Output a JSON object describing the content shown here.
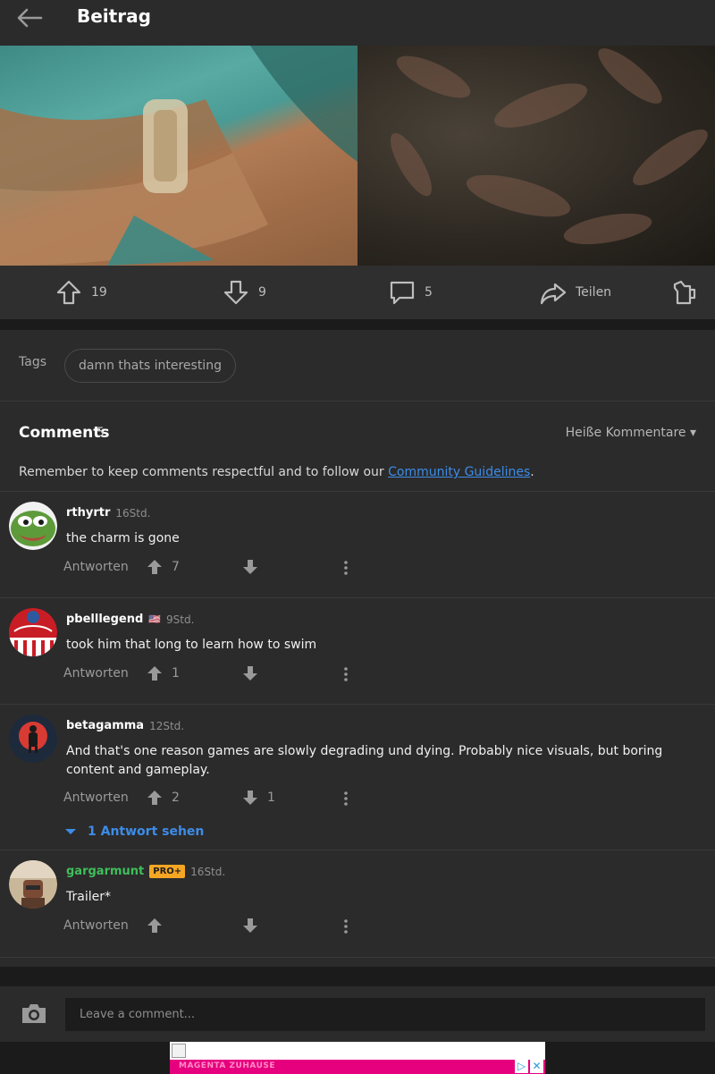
{
  "header": {
    "title": "Beitrag",
    "back_icon": "arrow-left-icon"
  },
  "post_actions": {
    "upvotes": "19",
    "downvotes": "9",
    "comments": "5",
    "share_label": "Teilen"
  },
  "tags": {
    "label": "Tags",
    "items": [
      "damn thats interesting"
    ]
  },
  "comments_section": {
    "title": "Comments",
    "count": "5",
    "sort_label": "Heiße Kommentare ▾",
    "guidelines_prefix": "Remember to keep comments respectful and to follow our ",
    "guidelines_link": "Community Guidelines",
    "guidelines_suffix": "."
  },
  "comments": [
    {
      "author": "rthyrtr",
      "time": "16Std.",
      "text": "the charm is gone",
      "reply_label": "Antworten",
      "up": "7",
      "down": ""
    },
    {
      "author": "pbelllegend",
      "flag": "🇺🇸",
      "time": "9Std.",
      "text": "took him that long to learn how to swim",
      "reply_label": "Antworten",
      "up": "1",
      "down": ""
    },
    {
      "author": "betagamma",
      "time": "12Std.",
      "text": "And that's one reason games are slowly degrading und dying. Probably nice visuals, but boring content and gameplay.",
      "reply_label": "Antworten",
      "up": "2",
      "down": "1",
      "see_replies": "1 Antwort sehen"
    },
    {
      "author": "gargarmunt",
      "badge": "PRO+",
      "time": "16Std.",
      "text": "Trailer*",
      "reply_label": "Antworten",
      "up": "",
      "down": ""
    }
  ],
  "compose": {
    "placeholder": "Leave a comment...",
    "camera_icon": "camera-icon"
  },
  "ad": {
    "text": "MAGENTA ZUHAUSE"
  },
  "colors": {
    "background": "#2b2b2b",
    "link": "#3d8ce8",
    "pro_badge": "#f5a623",
    "ad_magenta": "#e6007e"
  }
}
